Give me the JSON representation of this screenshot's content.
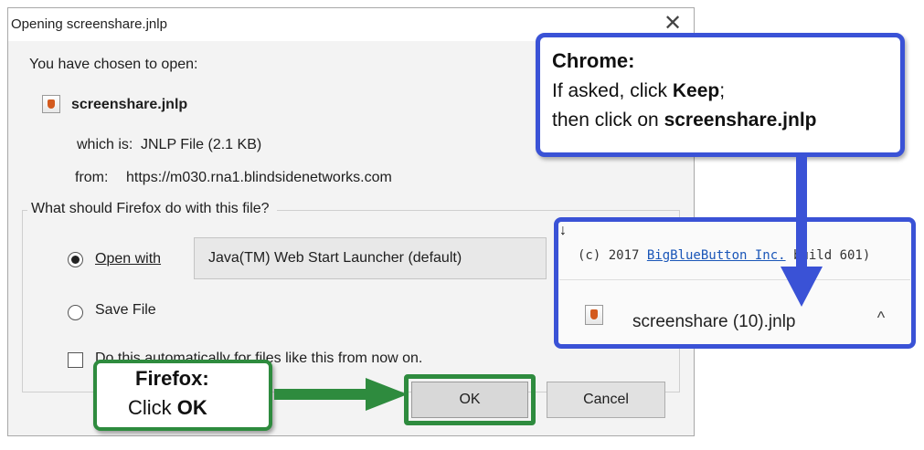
{
  "dialog": {
    "title": "Opening screenshare.jnlp",
    "close_glyph": "✕",
    "chosen_text": "You have chosen to open:",
    "file_icon": "java-jnlp-file-icon",
    "file_name": "screenshare.jnlp",
    "which_label": "which is:",
    "which_value": "JNLP File (2.1 KB)",
    "from_label": "from:",
    "from_value": "https://m030.rna1.blindsidenetworks.com",
    "question": "What should Firefox do with this file?",
    "open_with_label": "Open with",
    "open_with_selected": true,
    "app_value": "Java(TM) Web Start Launcher (default)",
    "save_label": "Save File",
    "auto_label": "Do this automatically for files like this from now on.",
    "ok_label": "OK",
    "cancel_label": "Cancel"
  },
  "firefox_callout": {
    "title": "Firefox:",
    "text_prefix": "Click ",
    "text_bold": "OK"
  },
  "chrome_callout": {
    "title": "Chrome:",
    "line1_prefix": "If asked, click ",
    "line1_bold": "Keep",
    "line1_suffix": ";",
    "line2_prefix": "then click on ",
    "line2_bold": "screenshare",
    "line2_suffix": ".jnlp"
  },
  "chrome_panel": {
    "copyright_prefix": "(c) 2017 ",
    "copyright_link": "BigBlueButton Inc.",
    "copyright_suffix": " build 601)",
    "download_icon": "java-jnlp-file-icon",
    "download_name": "screenshare (10).jnlp",
    "chevron_glyph": "^"
  },
  "colors": {
    "firefox_highlight": "#2e8b3e",
    "chrome_highlight": "#3a52d6"
  }
}
